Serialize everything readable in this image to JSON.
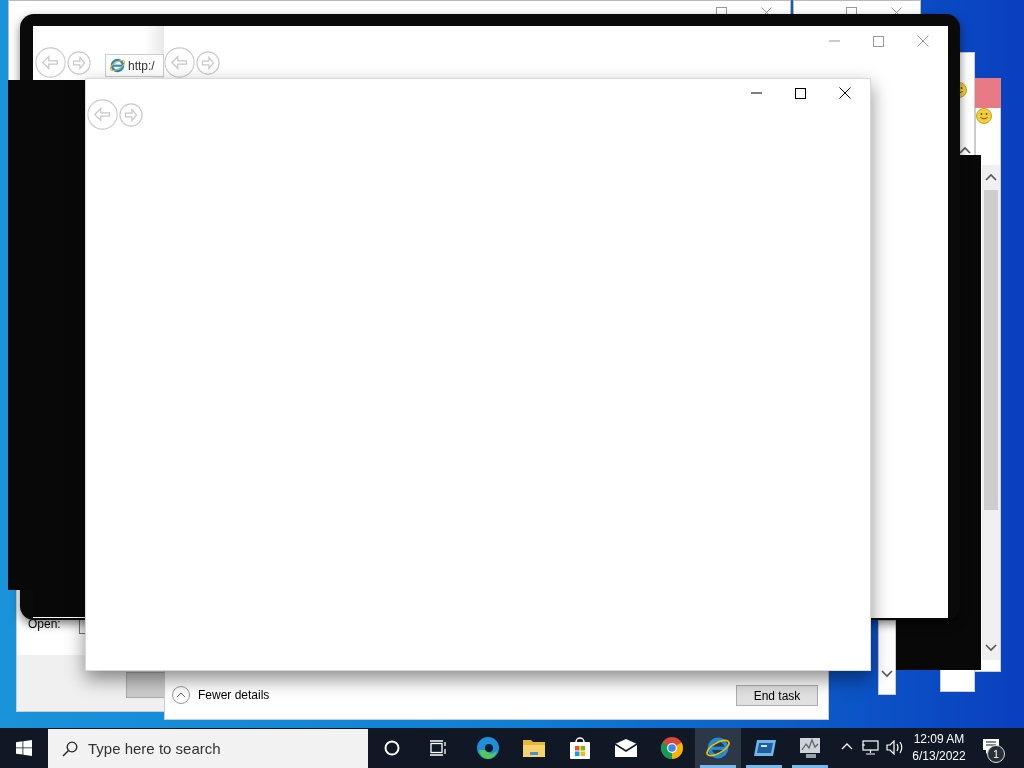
{
  "browser_window": {
    "address": "http:/"
  },
  "run_dialog": {
    "open_label": "Open:"
  },
  "task_manager": {
    "toggle": "Fewer details",
    "end_task": "End task"
  },
  "taskbar": {
    "search": {
      "placeholder": "Type here to search"
    },
    "apps": [
      {
        "kind": "edge",
        "selected": false,
        "running": false
      },
      {
        "kind": "explorer",
        "selected": false,
        "running": false
      },
      {
        "kind": "store",
        "selected": false,
        "running": false
      },
      {
        "kind": "mail",
        "selected": false,
        "running": false
      },
      {
        "kind": "chrome",
        "selected": false,
        "running": false
      },
      {
        "kind": "ie",
        "selected": true,
        "running": true
      },
      {
        "kind": "remote",
        "selected": false,
        "running": true
      },
      {
        "kind": "monitor",
        "selected": false,
        "running": true
      }
    ],
    "clock": {
      "time": "12:09 AM",
      "date": "6/13/2022"
    },
    "notifications": {
      "count": "1"
    }
  }
}
